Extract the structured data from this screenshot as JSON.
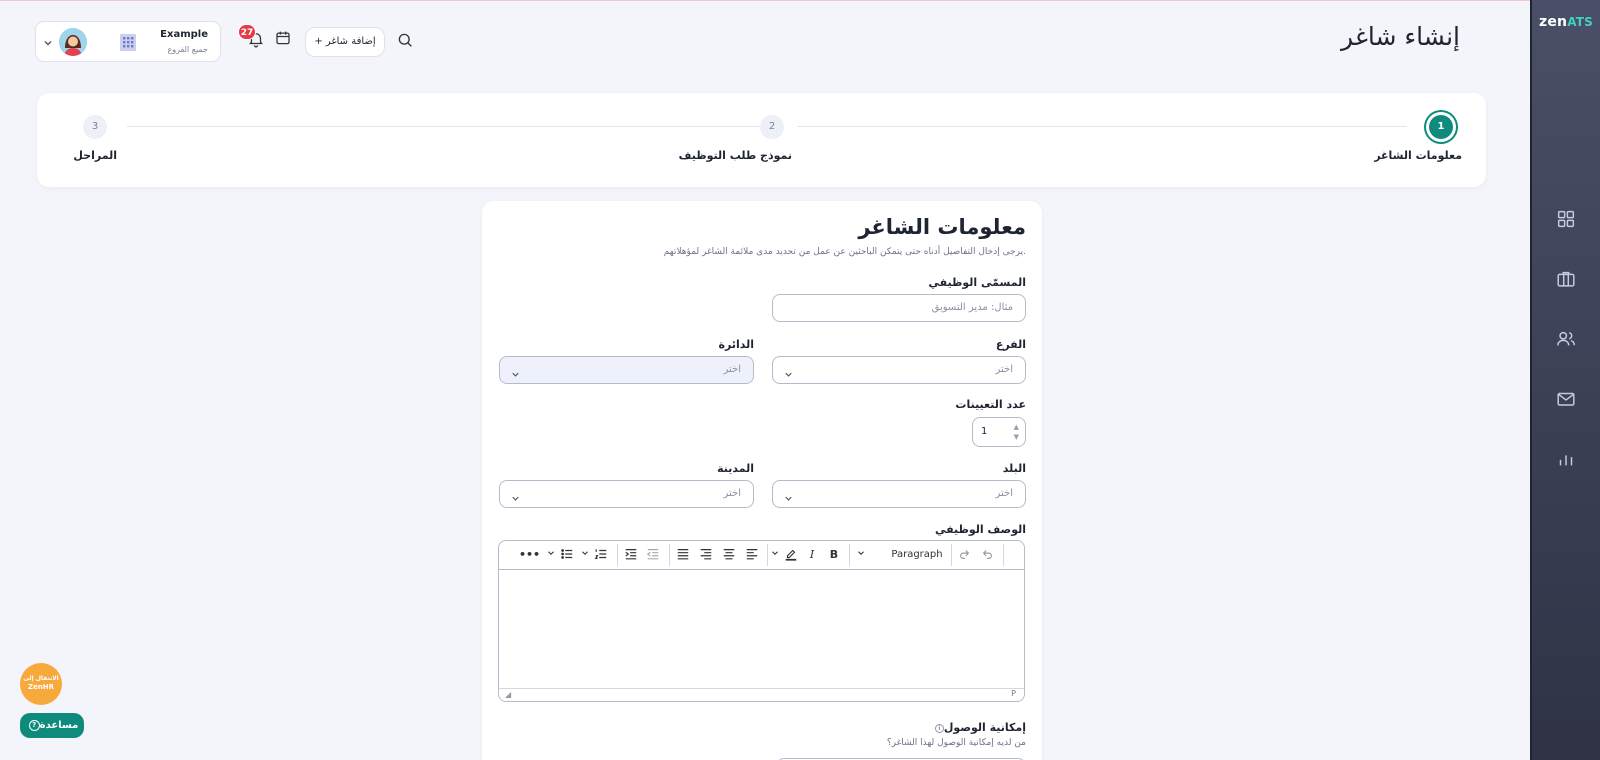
{
  "app": {
    "logo_main": "zen",
    "logo_accent": "ATS",
    "page_title": "إنشاء شاغر"
  },
  "header": {
    "user_name": "Example",
    "user_sub": "جميع الفروع",
    "notifications_count": "27",
    "add_vacancy_label": "+ إضافة شاغر"
  },
  "sidebar": {
    "icons": [
      "dashboard-icon",
      "briefcase-icon",
      "users-icon",
      "mail-icon",
      "chart-icon"
    ]
  },
  "stepper": {
    "steps": [
      {
        "number": "1",
        "label": "معلومات الشاغر",
        "active": true
      },
      {
        "number": "2",
        "label": "نموذج طلب التوظيف",
        "active": false
      },
      {
        "number": "3",
        "label": "المراحل",
        "active": false
      }
    ]
  },
  "form": {
    "title": "معلومات الشاغر",
    "subtitle": "يرجى إدخال التفاصيل أدناه حتى يتمكن الباحثين عن عمل من تحديد مدى ملائمة الشاغر لمؤهلاتهم.",
    "job_title_label": "المسمّى الوظيفي",
    "job_title_placeholder": "مثال: مدير التسويق",
    "branch_label": "الفرع",
    "branch_value": "اختر",
    "department_label": "الدائرة",
    "department_value": "اختر",
    "openings_label": "عدد التعيينات",
    "openings_value": "1",
    "country_label": "البلد",
    "country_value": "اختر",
    "city_label": "المدينة",
    "city_value": "اختر",
    "description_label": "الوصف الوظيفي",
    "editor_paragraph": "Paragraph",
    "editor_status": "P",
    "access_label": "إمكانية الوصول",
    "access_hint": "من لديه إمكانية الوصول لهذا الشاغر؟"
  },
  "widgets": {
    "zenhr_line1": "الانتقال إلى",
    "zenhr_line2": "ZenHR",
    "help_label": "مساعدة"
  },
  "colors": {
    "accent": "#0f8b7e",
    "sidebar": "#3a3e54",
    "badge": "#e23b45",
    "zenhr": "#f7a93b"
  }
}
